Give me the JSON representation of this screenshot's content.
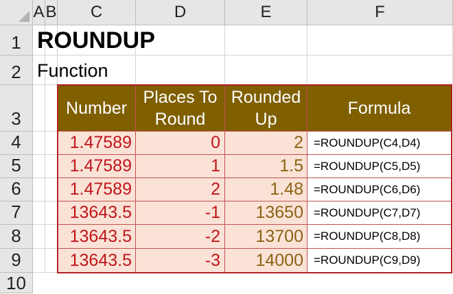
{
  "sheet": {
    "column_headers": [
      "A",
      "B",
      "C",
      "D",
      "E",
      "F"
    ],
    "row_headers": [
      "1",
      "2",
      "3",
      "4",
      "5",
      "6",
      "7",
      "8",
      "9",
      "10"
    ],
    "title": "ROUNDUP",
    "subtitle": "Function",
    "table": {
      "headers": {
        "number": "Number",
        "places_line1": "Places To",
        "places_line2": "Round",
        "rounded_line1": "Rounded",
        "rounded_line2": "Up",
        "formula": "Formula"
      },
      "rows": [
        {
          "number": "1.47589",
          "places": "0",
          "rounded": "2",
          "formula": "=ROUNDUP(C4,D4)"
        },
        {
          "number": "1.47589",
          "places": "1",
          "rounded": "1.5",
          "formula": "=ROUNDUP(C5,D5)"
        },
        {
          "number": "1.47589",
          "places": "2",
          "rounded": "1.48",
          "formula": "=ROUNDUP(C6,D6)"
        },
        {
          "number": "13643.5",
          "places": "-1",
          "rounded": "13650",
          "formula": "=ROUNDUP(C7,D7)"
        },
        {
          "number": "13643.5",
          "places": "-2",
          "rounded": "13700",
          "formula": "=ROUNDUP(C8,D8)"
        },
        {
          "number": "13643.5",
          "places": "-3",
          "rounded": "14000",
          "formula": "=ROUNDUP(C9,D9)"
        }
      ]
    }
  },
  "colors": {
    "header_fill": "#7f5f00",
    "data_fill": "#fbe2d6",
    "number_text": "#c0161d",
    "rounded_text": "#8a6414",
    "table_border": "#b02020"
  }
}
